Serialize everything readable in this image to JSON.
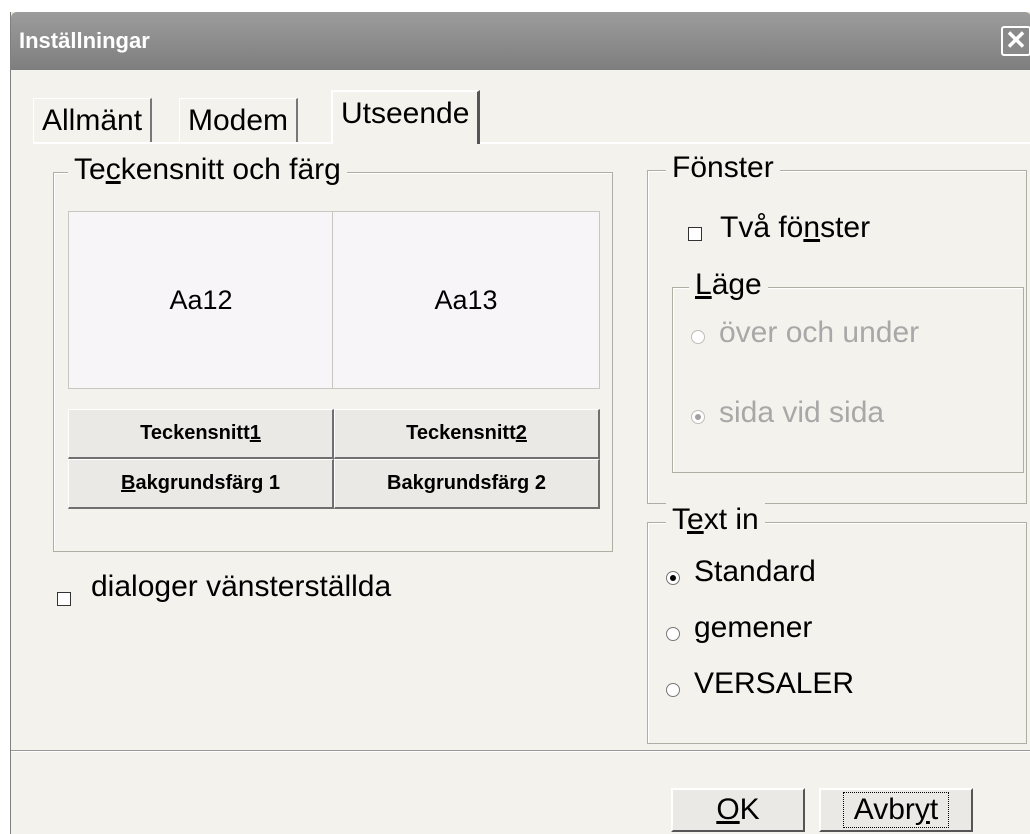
{
  "window": {
    "title": "Inställningar"
  },
  "tabs": [
    {
      "label": "Allmänt"
    },
    {
      "label": "Modem"
    },
    {
      "label": "Utseende"
    }
  ],
  "font_color_group": {
    "legend_pre": "Te",
    "legend_u": "c",
    "legend_post": "kensnitt  och färg",
    "preview1": "Aa12",
    "preview2": "Aa13",
    "font1_pre": "Teckensnitt ",
    "font1_u": "1",
    "font2_pre": "Teckensnitt ",
    "font2_u": "2",
    "bg1_u": "B",
    "bg1_post": "akgrundsfärg 1",
    "bg2_pre": "Bak",
    "bg2_u": "g",
    "bg2_post": "rundsfärg 2"
  },
  "left_dialogs_checkbox": {
    "label": "dialoger vänsterställda",
    "checked": false
  },
  "window_group": {
    "legend": "Fönster",
    "two_windows_pre": "Två fö",
    "two_windows_u": "n",
    "two_windows_post": "ster",
    "two_windows_checked": false,
    "position_legend_u": "L",
    "position_legend_post": "äge",
    "options": [
      {
        "label": "över och under",
        "checked": false,
        "enabled": false
      },
      {
        "label": "sida vid sida",
        "checked": true,
        "enabled": false
      }
    ]
  },
  "text_in_group": {
    "legend_pre": "T",
    "legend_u": "e",
    "legend_post": "xt in",
    "options": [
      {
        "label": "Standard",
        "checked": true
      },
      {
        "label": "gemener",
        "checked": false
      },
      {
        "label": "VERSALER",
        "checked": false
      }
    ]
  },
  "buttons": {
    "ok_u": "O",
    "ok_post": "K",
    "cancel_pre": "Avbr",
    "cancel_u": "y",
    "cancel_post": "t"
  },
  "colors": {
    "title_bar": "#8a8a8a",
    "dialog_bg": "#f4f2ec",
    "disabled_text": "#a8a8a8"
  },
  "icons": {
    "close": "close-icon"
  }
}
